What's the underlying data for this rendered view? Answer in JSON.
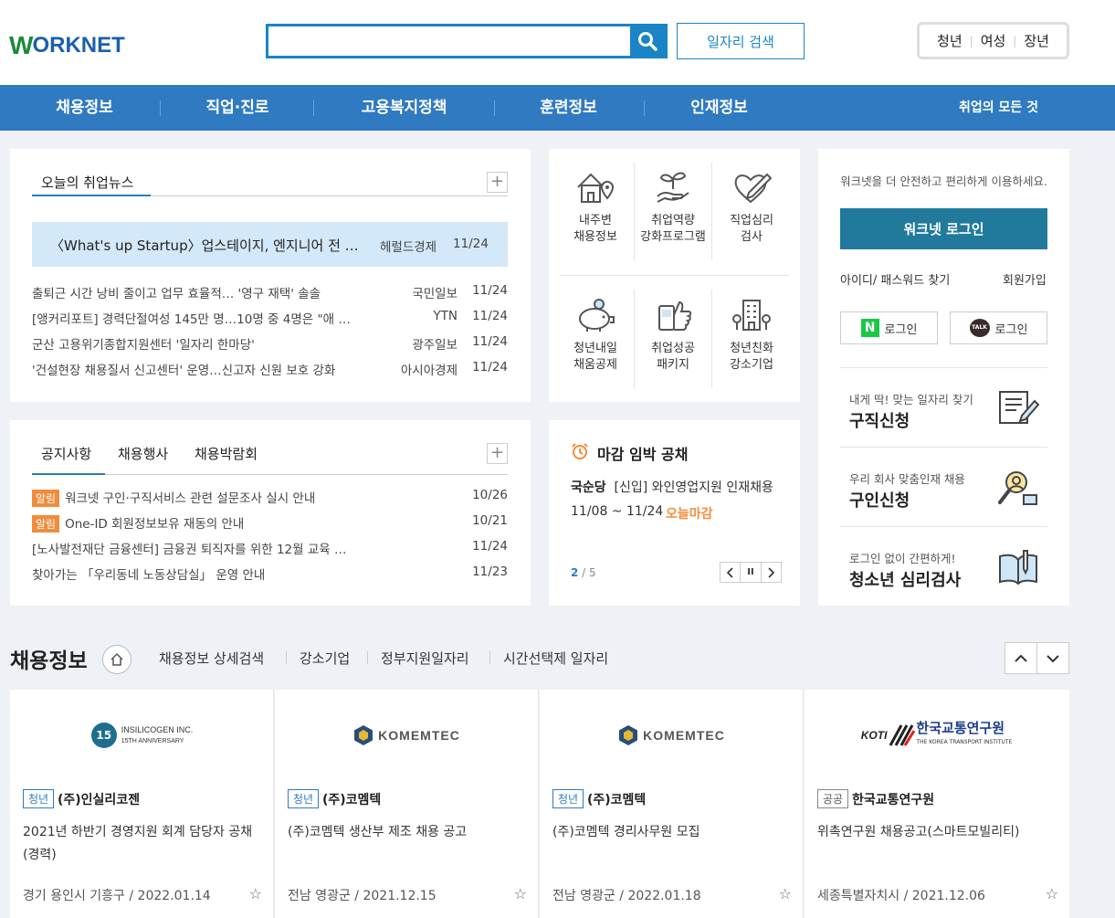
{
  "header": {
    "logo_w": "W",
    "logo_rest": "ORKNET",
    "search_placeholder": "",
    "job_search_label": "일자리 검색",
    "targets": [
      "청년",
      "여성",
      "장년"
    ]
  },
  "nav": {
    "items": [
      "채용정보",
      "직업·진로",
      "고용복지정책",
      "훈련정보",
      "인재정보"
    ],
    "all_label": "취업의 모든 것"
  },
  "news": {
    "tab": "오늘의 취업뉴스",
    "highlight": {
      "title": "〈What's up Startup〉업스테이지, 엔지니어 전 직…",
      "source": "헤럴드경제",
      "date": "11/24"
    },
    "rows": [
      {
        "title": "출퇴근 시간 낭비 줄이고 업무 효율적… '영구 재택' 솔솔",
        "source": "국민일보",
        "date": "11/24"
      },
      {
        "title": "[앵커리포트] 경력단절여성 145만 명…10명 중 4명은 \"애 …",
        "source": "YTN",
        "date": "11/24"
      },
      {
        "title": "군산 고용위기종합지원센터 '일자리 한마당'",
        "source": "광주일보",
        "date": "11/24"
      },
      {
        "title": "'건설현장 채용질서 신고센터' 운영…신고자 신원 보호 강화",
        "source": "아시아경제",
        "date": "11/24"
      }
    ]
  },
  "notice": {
    "tabs": [
      "공지사항",
      "채용행사",
      "채용박람회"
    ],
    "badge": "알림",
    "rows": [
      {
        "badge": true,
        "title": "워크넷 구인·구직서비스 관련 설문조사 실시 안내",
        "date": "10/26"
      },
      {
        "badge": true,
        "title": "One-ID 회원정보보유 재동의 안내",
        "date": "10/21"
      },
      {
        "badge": false,
        "title": "[노사발전재단 금융센터] 금융권 퇴직자를 위한 12월 교육 …",
        "date": "11/24"
      },
      {
        "badge": false,
        "title": "찾아가는 「우리동네 노동상담실」 운영 안내",
        "date": "11/23"
      }
    ]
  },
  "services": [
    {
      "l1": "내주변",
      "l2": "채용정보"
    },
    {
      "l1": "취업역량",
      "l2": "강화프로그램"
    },
    {
      "l1": "직업심리",
      "l2": "검사"
    },
    {
      "l1": "청년내일",
      "l2": "채움공제"
    },
    {
      "l1": "취업성공",
      "l2": "패키지"
    },
    {
      "l1": "청년친화",
      "l2": "강소기업"
    }
  ],
  "deadline": {
    "title": "마감 임박 공채",
    "company": "국순당",
    "job": "[신입] 와인영업지원 인재채용",
    "period": "11/08 ~ 11/24",
    "status": "오늘마감",
    "page_current": "2",
    "page_sep": " / ",
    "page_total": "5",
    "pause_glyph": "II"
  },
  "login": {
    "intro": "워크넷을 더 안전하고 편리하게 이용하세요.",
    "login_button": "워크넷 로그인",
    "find": "아이디/ 패스워드 찾기",
    "join": "회원가입",
    "naver_mark": "N",
    "naver": "로그인",
    "kakao_mark": "TALK",
    "kakao": "로그인"
  },
  "right_links": [
    {
      "sub": "내게 딱! 맞는 일자리 찾기",
      "main": "구직신청"
    },
    {
      "sub": "우리 회사 맞춤인재 채용",
      "main": "구인신청"
    },
    {
      "sub": "로그인 없이 간편하게!",
      "main": "청소년 심리검사"
    }
  ],
  "jobs": {
    "title": "채용정보",
    "links": [
      "채용정보 상세검색",
      "강소기업",
      "정부지원일자리",
      "시간선택제 일자리"
    ],
    "cards": [
      {
        "logo_mark": "15",
        "logo": "INSILICOGEN INC.",
        "logo_sub": "15TH ANNIVERSARY",
        "tag": "청년",
        "company": "(주)인실리코젠",
        "title": "2021년 하반기 경영지원 회계 담당자 공채(경력)",
        "meta": "경기 용인시 기흥구 / 2022.01.14"
      },
      {
        "logo": "KOMEMTEC",
        "tag": "청년",
        "company": "(주)코멤텍",
        "title": "(주)코멤텍 생산부 제조 채용 공고",
        "meta": "전남 영광군 / 2021.12.15"
      },
      {
        "logo": "KOMEMTEC",
        "tag": "청년",
        "company": "(주)코멤텍",
        "title": "(주)코멤텍 경리사무원 모집",
        "meta": "전남 영광군 / 2022.01.18"
      },
      {
        "logo_mark": "KOTI",
        "logo": "한국교통연구원",
        "logo_sub": "THE KOREA TRANSPORT INSTITUTE",
        "tag": "공공",
        "company": "한국교통연구원",
        "title": "위촉연구원 채용공고(스마트모빌리티)",
        "meta": "세종특별자치시 / 2021.12.06"
      }
    ]
  },
  "colors": {
    "brand_blue": "#2f7ac1",
    "accent_orange": "#f08d3c",
    "search_blue": "#1a84c7"
  }
}
